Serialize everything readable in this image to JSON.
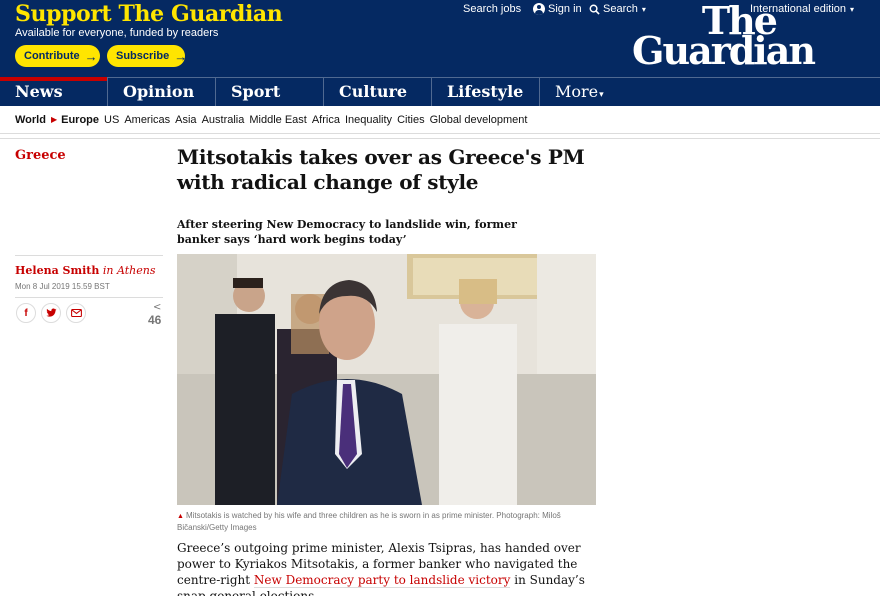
{
  "support": {
    "title": "Support The Guardian",
    "subtitle": "Available for everyone, funded by readers",
    "contribute_label": "Contribute",
    "subscribe_label": "Subscribe"
  },
  "utility": {
    "search_jobs": "Search jobs",
    "sign_in": "Sign in",
    "search": "Search",
    "edition": "International edition"
  },
  "logo": {
    "line1": "The",
    "line2": "Guardian"
  },
  "pillars": [
    "News",
    "Opinion",
    "Sport",
    "Culture",
    "Lifestyle",
    "More"
  ],
  "subnav": {
    "world": "World",
    "current": "Europe",
    "items": [
      "US",
      "Americas",
      "Asia",
      "Australia",
      "Middle East",
      "Africa",
      "Inequality",
      "Cities",
      "Global development"
    ]
  },
  "article": {
    "section": "Greece",
    "headline": "Mitsotakis takes over as Greece's PM with radical change of style",
    "standfirst": "After steering New Democracy to landslide win, former banker says ‘hard work begins today’",
    "author": "Helena Smith",
    "location": "in Athens",
    "date": "Mon 8 Jul 2019 15.59 BST",
    "share_count": "46",
    "caption": "Mitsotakis is watched by his wife and three children as he is sworn in as prime minister. Photograph: Miloš Bičanski/Getty Images",
    "body_before": "Greece’s outgoing prime minister, Alexis Tsipras, has handed over power to Kyriakos Mitsotakis, a former banker who navigated the centre-right ",
    "body_link": "New Democracy party to landslide victory",
    "body_after": " in Sunday’s snap general elections."
  },
  "colors": {
    "brand_blue": "#052962",
    "support_yellow": "#ffe500",
    "news_red": "#c70000"
  }
}
